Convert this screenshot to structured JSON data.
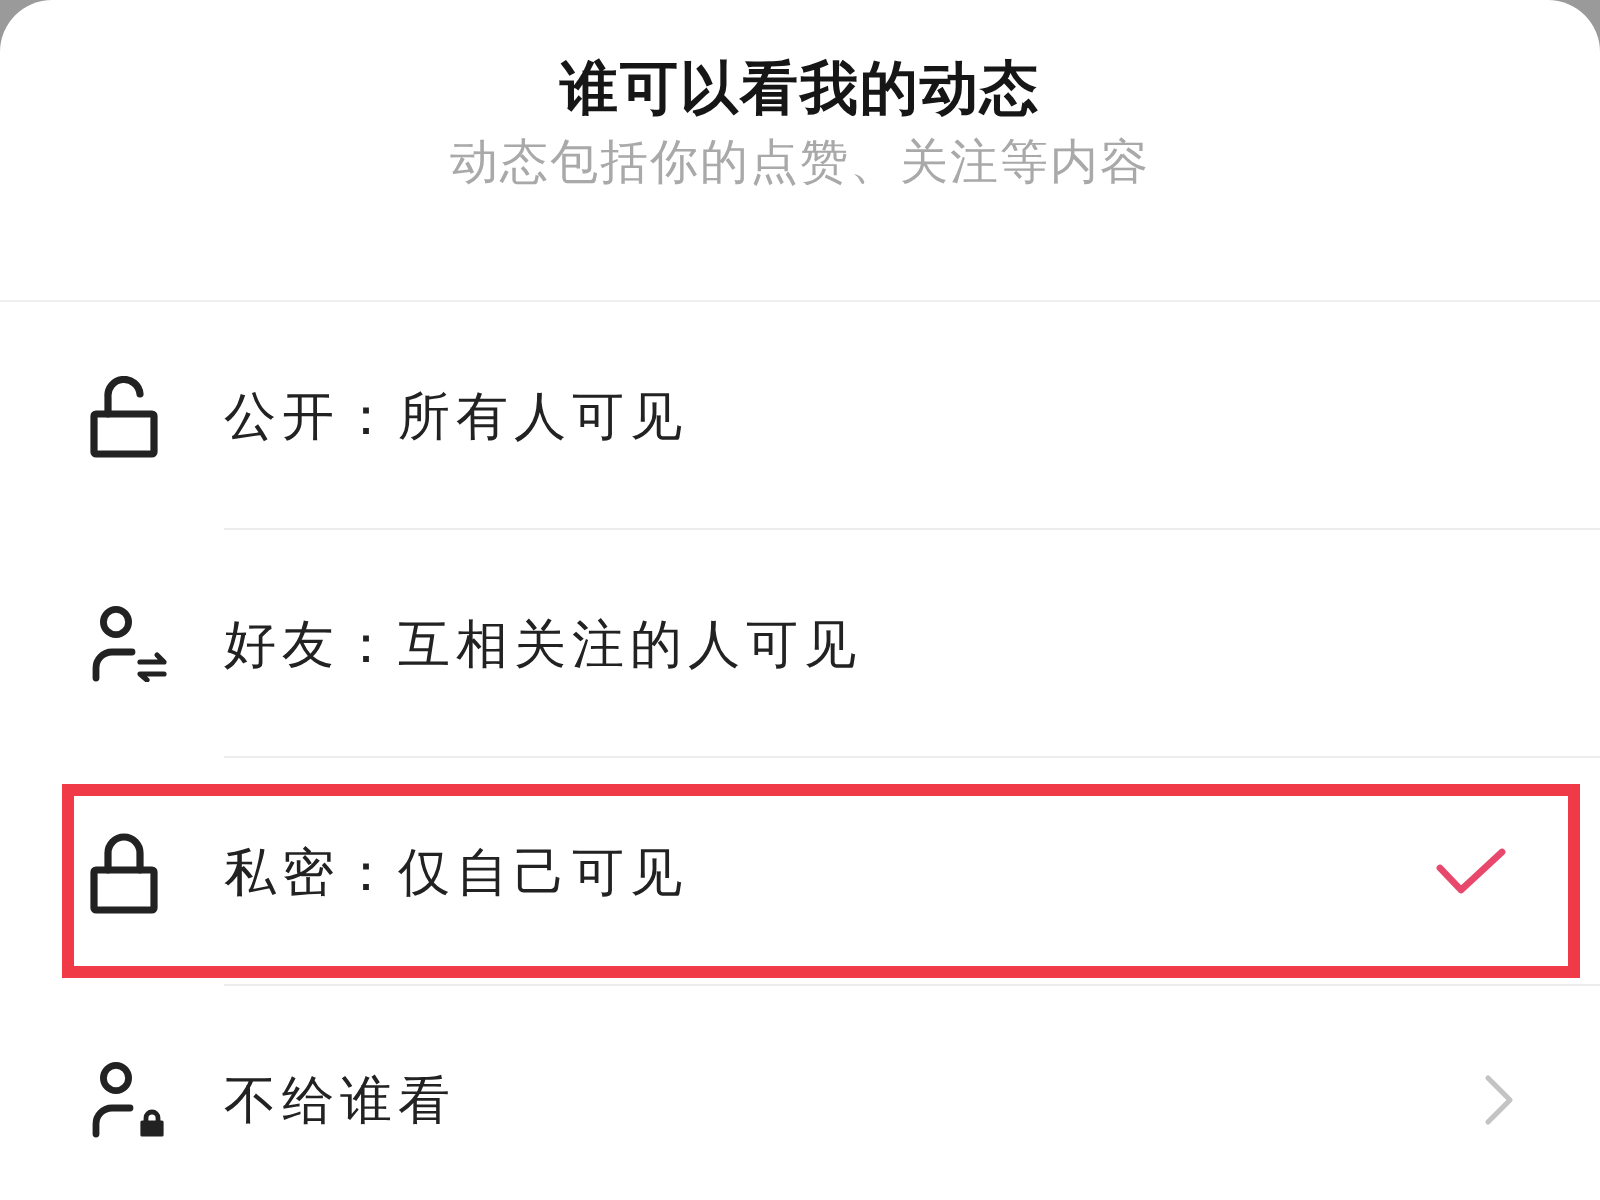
{
  "sheet": {
    "title": "谁可以看我的动态",
    "subtitle": "动态包括你的点赞、关注等内容"
  },
  "options": [
    {
      "label": "公开：所有人可见",
      "kind": "choice",
      "selected": false,
      "highlighted": false
    },
    {
      "label": "好友：互相关注的人可见",
      "kind": "choice",
      "selected": false,
      "highlighted": false
    },
    {
      "label": "私密：仅自己可见",
      "kind": "choice",
      "selected": true,
      "highlighted": true
    },
    {
      "label": "不给谁看",
      "kind": "link",
      "selected": false,
      "highlighted": false
    }
  ]
}
